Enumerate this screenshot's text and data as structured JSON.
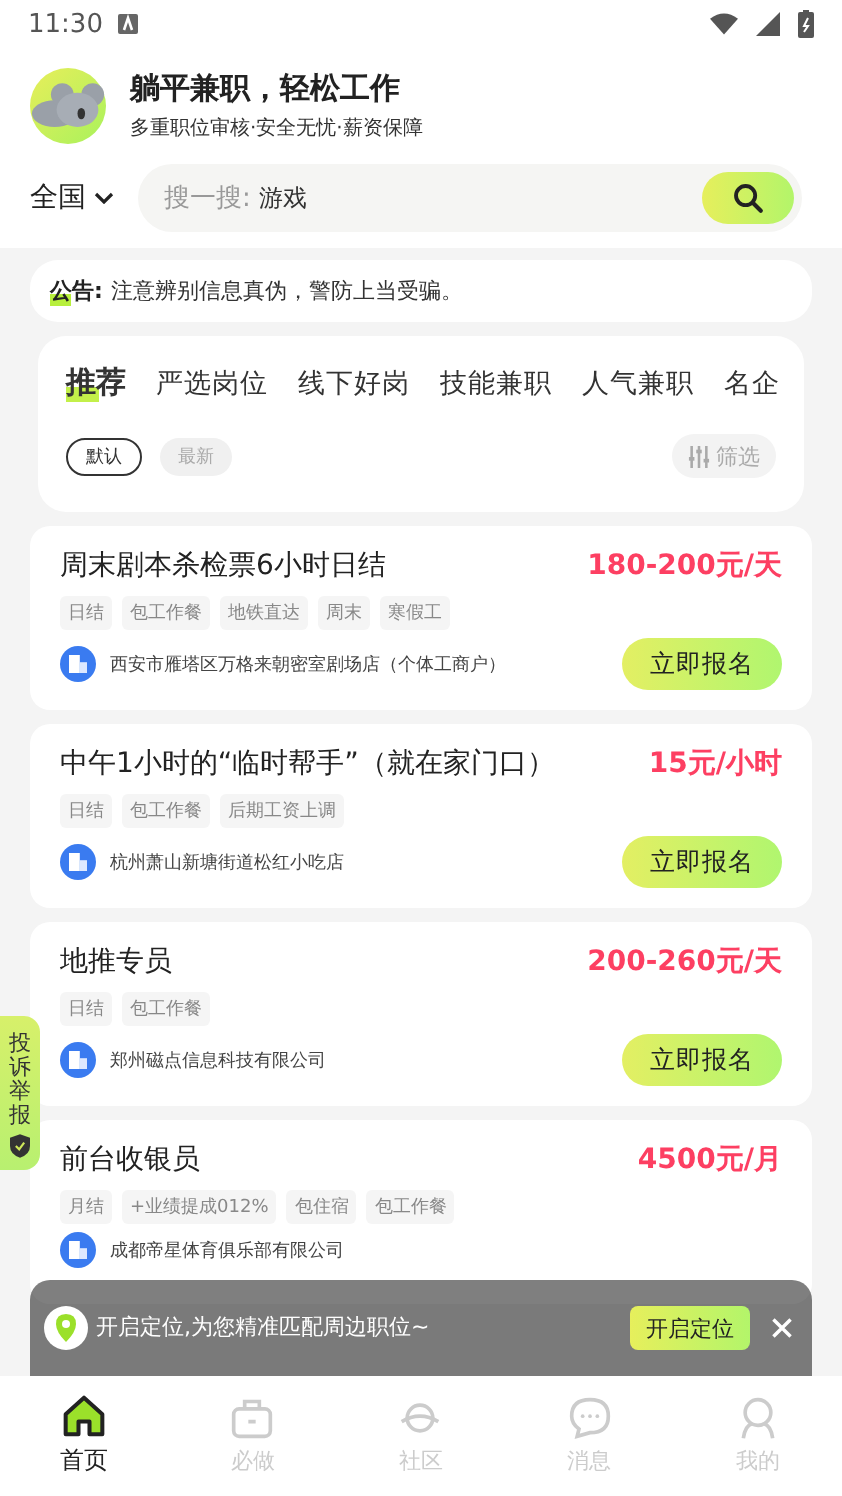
{
  "status_bar": {
    "time": "11:30"
  },
  "header": {
    "title": "躺平兼职，轻松工作",
    "subtitle": "多重职位审核·安全无忧·薪资保障"
  },
  "search": {
    "region": "全国",
    "prefix": "搜一搜:",
    "keyword": "游戏"
  },
  "notice": {
    "label": "公告:",
    "text": "注意辨别信息真伪，警防上当受骗。"
  },
  "category_tabs": [
    {
      "label": "推荐",
      "selected": true
    },
    {
      "label": "严选岗位",
      "selected": false
    },
    {
      "label": "线下好岗",
      "selected": false
    },
    {
      "label": "技能兼职",
      "selected": false
    },
    {
      "label": "人气兼职",
      "selected": false
    },
    {
      "label": "名企",
      "selected": false
    }
  ],
  "sort_chips": [
    {
      "label": "默认",
      "selected": true
    },
    {
      "label": "最新",
      "selected": false
    }
  ],
  "filter_button": "筛选",
  "jobs": [
    {
      "title": "周末剧本杀检票6小时日结",
      "pay": "180-200元/天",
      "tags": [
        "日结",
        "包工作餐",
        "地铁直达",
        "周末",
        "寒假工"
      ],
      "company": "西安市雁塔区万格来朝密室剧场店（个体工商户）",
      "apply": "立即报名"
    },
    {
      "title": "中午1小时的“临时帮手”（就在家门口）",
      "pay": "15元/小时",
      "tags": [
        "日结",
        "包工作餐",
        "后期工资上调"
      ],
      "company": "杭州萧山新塘街道松红小吃店",
      "apply": "立即报名"
    },
    {
      "title": "地推专员",
      "pay": "200-260元/天",
      "tags": [
        "日结",
        "包工作餐"
      ],
      "company": "郑州磁点信息科技有限公司",
      "apply": "立即报名"
    },
    {
      "title": "前台收银员",
      "pay": "4500元/月",
      "tags": [
        "月结",
        "+业绩提成012%",
        "包住宿",
        "包工作餐"
      ],
      "company": "成都帝星体育俱乐部有限公司"
    }
  ],
  "side_tab": "投诉举报",
  "location_toast": {
    "text": "开启定位,为您精准匹配周边职位~",
    "button": "开启定位"
  },
  "bottom_nav": [
    {
      "label": "首页",
      "kind": "home",
      "selected": true
    },
    {
      "label": "必做",
      "kind": "bag",
      "selected": false
    },
    {
      "label": "社区",
      "kind": "planet",
      "selected": false
    },
    {
      "label": "消息",
      "kind": "chat",
      "selected": false
    },
    {
      "label": "我的",
      "kind": "person",
      "selected": false
    }
  ]
}
